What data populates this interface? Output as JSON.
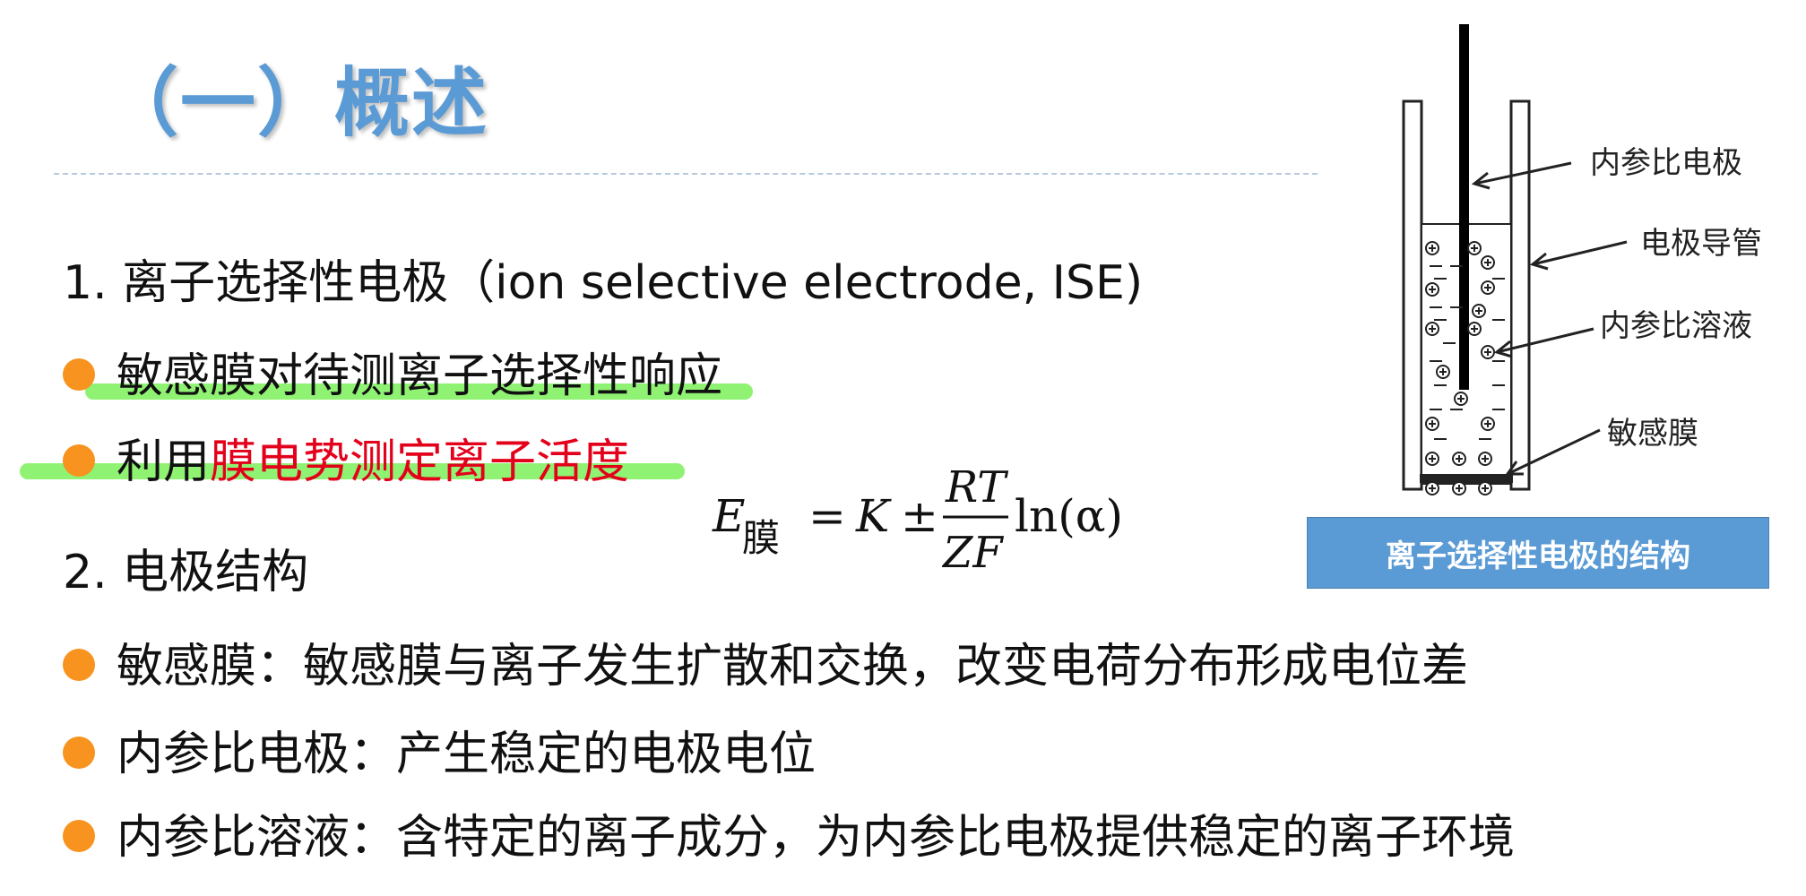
{
  "title": "（一）概述",
  "section1": {
    "heading": "1. 离子选择性电极（ion selective electrode, ISE)",
    "bullets": [
      {
        "text": "敏感膜对待测离子选择性响应"
      },
      {
        "text_plain": "利用",
        "text_red": "膜电势测定离子活度"
      }
    ]
  },
  "formula": {
    "lhs_symbol": "E",
    "lhs_subscript": "膜",
    "equals": "=",
    "constant": "K",
    "plus_minus": "±",
    "numerator": "RT",
    "denominator": "ZF",
    "log_term": "ln(α)"
  },
  "section2": {
    "heading": "2. 电极结构",
    "bullets": [
      {
        "text": "敏感膜：敏感膜与离子发生扩散和交换，改变电荷分布形成电位差"
      },
      {
        "text": "内参比电极：产生稳定的电极电位"
      },
      {
        "text": "内参比溶液：含特定的离子成分，为内参比电极提供稳定的离子环境"
      }
    ]
  },
  "diagram": {
    "labels": {
      "internal_reference_electrode": "内参比电极",
      "electrode_tube": "电极导管",
      "internal_reference_solution": "内参比溶液",
      "sensitive_membrane": "敏感膜"
    },
    "caption": "离子选择性电极的结构"
  },
  "colors": {
    "title": "#5b9bd5",
    "bullet": "#f7931e",
    "highlight": "#7cf05a",
    "emphasis_red": "#e3001b",
    "caption_bg": "#5b9bd5"
  }
}
